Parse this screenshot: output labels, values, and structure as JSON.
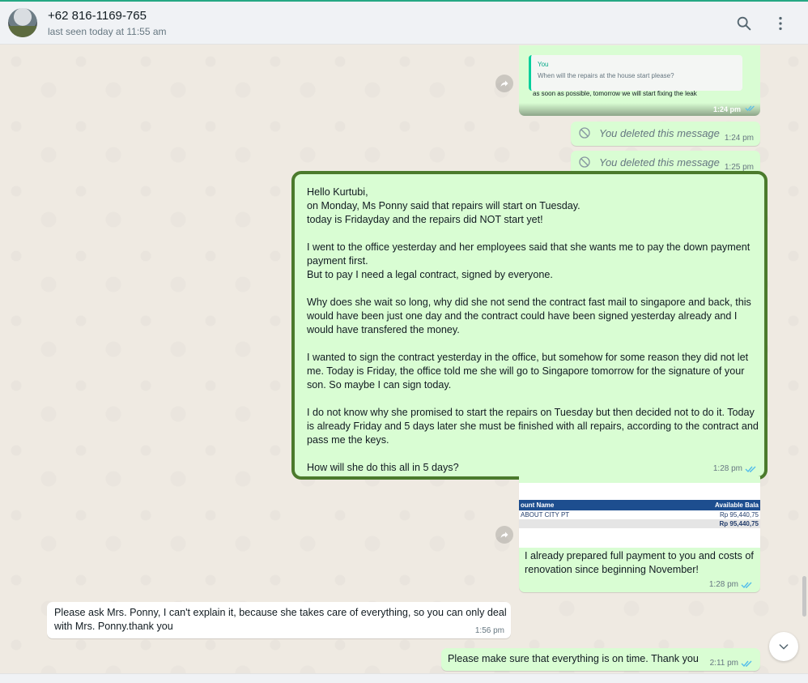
{
  "header": {
    "contact_name": "+62 816-1169-765",
    "status": "last seen today at 11:55 am",
    "icons": [
      "search-icon",
      "menu-dots-icon"
    ]
  },
  "colors": {
    "outgoing_bubble": "#d9fdd3",
    "incoming_bubble": "#ffffff",
    "read_ticks": "#53bdeb",
    "highlight_border": "#4b7a2c",
    "chat_background": "#efeae2"
  },
  "messages": {
    "quoted": {
      "from": "You",
      "quoted_text": "When will the repairs at the house start please?",
      "reply_text": "as soon as possible, tomorrow we will start fixing the leak",
      "time": "1:24 pm"
    },
    "deleted_1": {
      "text": "You deleted this message",
      "time": "1:24 pm"
    },
    "deleted_2": {
      "text": "You deleted this message",
      "time": "1:25 pm"
    },
    "long": {
      "paragraphs": [
        "Hello Kurtubi,\non Monday, Ms Ponny said that repairs will start on Tuesday.\ntoday is Fridayday and the repairs did NOT start yet!",
        "I went to the office yesterday and her employees said that she wants me to pay the down payment payment first.\nBut to pay I need a legal contract, signed by everyone.",
        "Why does she wait so long, why did she not send the contract fast mail to singapore and back, this would have been just one day and the contract could have been signed yesterday already and I would have transfered the money.",
        "I wanted to sign the contract yesterday in the office, but somehow for some reason they did not let me. Today is Friday, the office told me she will go to Singapore tomorrow for the signature of your son. So maybe I can sign today.",
        "I do not know why she promised to start the repairs on Tuesday but then decided not to do it. Today is already Friday and 5 days later she must be finished with all repairs, according to the contract and pass me the keys.",
        "How will she do this all in 5 days?"
      ],
      "time": "1:28 pm"
    },
    "image_msg": {
      "table_headers": [
        "ount Name",
        "Available Bala"
      ],
      "table_rows": [
        [
          "ABOUT CITY PT",
          "Rp 95,440,75"
        ],
        [
          "",
          "Rp 95,440,75"
        ]
      ],
      "caption": "I already prepared full payment to you and costs of renovation since beginning November!",
      "time": "1:28 pm"
    },
    "incoming": {
      "text": "Please ask Mrs. Ponny, I can't explain it, because she takes care of everything, so you can only deal with Mrs. Ponny.thank you",
      "time": "1:56 pm"
    },
    "last": {
      "text": "Please make sure that everything is on time. Thank you",
      "time": "2:11 pm"
    }
  }
}
